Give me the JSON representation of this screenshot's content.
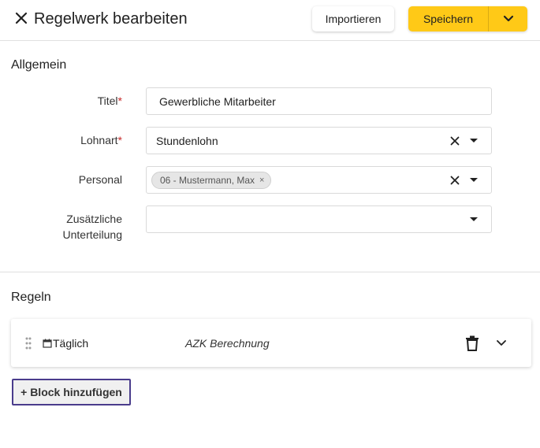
{
  "header": {
    "title": "Regelwerk bearbeiten",
    "import_label": "Importieren",
    "save_label": "Speichern"
  },
  "general": {
    "section_title": "Allgemein",
    "title_field": {
      "label": "Titel",
      "required_mark": "*",
      "value": "Gewerbliche Mitarbeiter"
    },
    "wage_type_field": {
      "label": "Lohnart",
      "required_mark": "*",
      "value": "Stundenlohn"
    },
    "personnel_field": {
      "label": "Personal",
      "chips": [
        "06 - Mustermann, Max"
      ],
      "chip_remove": "×"
    },
    "subdivision_field": {
      "label_line1": "Zusätzliche",
      "label_line2": "Unterteilung",
      "value": ""
    }
  },
  "rules": {
    "section_title": "Regeln",
    "items": [
      {
        "name": "Täglich",
        "calculation": "AZK Berechnung"
      }
    ],
    "add_block_label": "+ Block hinzufügen"
  },
  "colors": {
    "accent": "#ffc917",
    "focus_border": "#4a3c8c",
    "required": "#c62828"
  }
}
